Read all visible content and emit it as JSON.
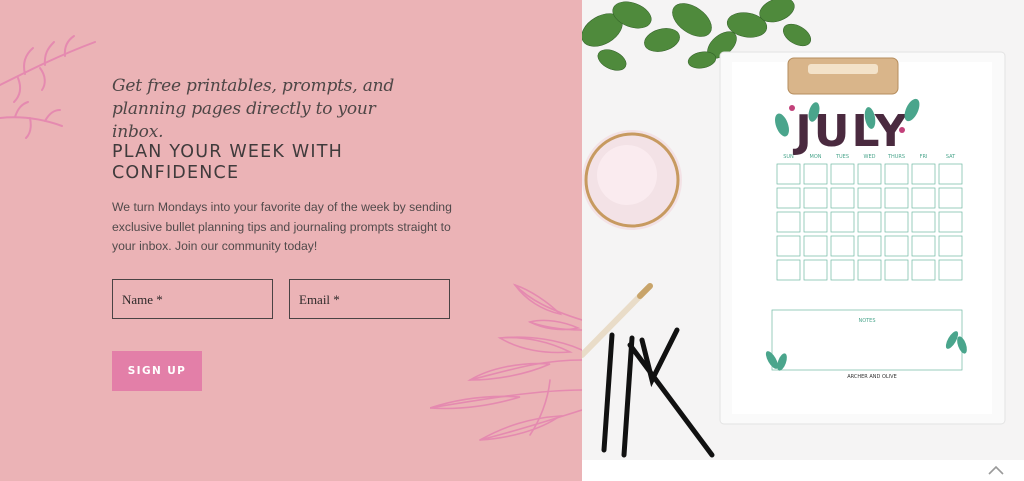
{
  "signup": {
    "tagline": "Get free printables, prompts, and planning pages directly to your inbox.",
    "heading": "PLAN YOUR WEEK WITH CONFIDENCE",
    "body": "We turn Mondays into your favorite day of the week by sending exclusive bullet planning tips and journaling prompts straight to your inbox. Join our community today!",
    "name_placeholder": "Name *",
    "email_placeholder": "Email *",
    "button_label": "SIGN UP"
  },
  "photo": {
    "calendar_month": "JULY",
    "weekdays": [
      "SUN",
      "MON",
      "TUES",
      "WED",
      "THURS",
      "FRI",
      "SAT"
    ],
    "notes_label": "NOTES",
    "brand": "ARCHER AND OLIVE"
  },
  "colors": {
    "panel_bg": "#ebb3b6",
    "accent_pink": "#e37fa8",
    "calendar_green": "#4aa58c",
    "calendar_month": "#4a2a3f"
  },
  "icons": {
    "scroll_top": "chevron-up-icon"
  }
}
